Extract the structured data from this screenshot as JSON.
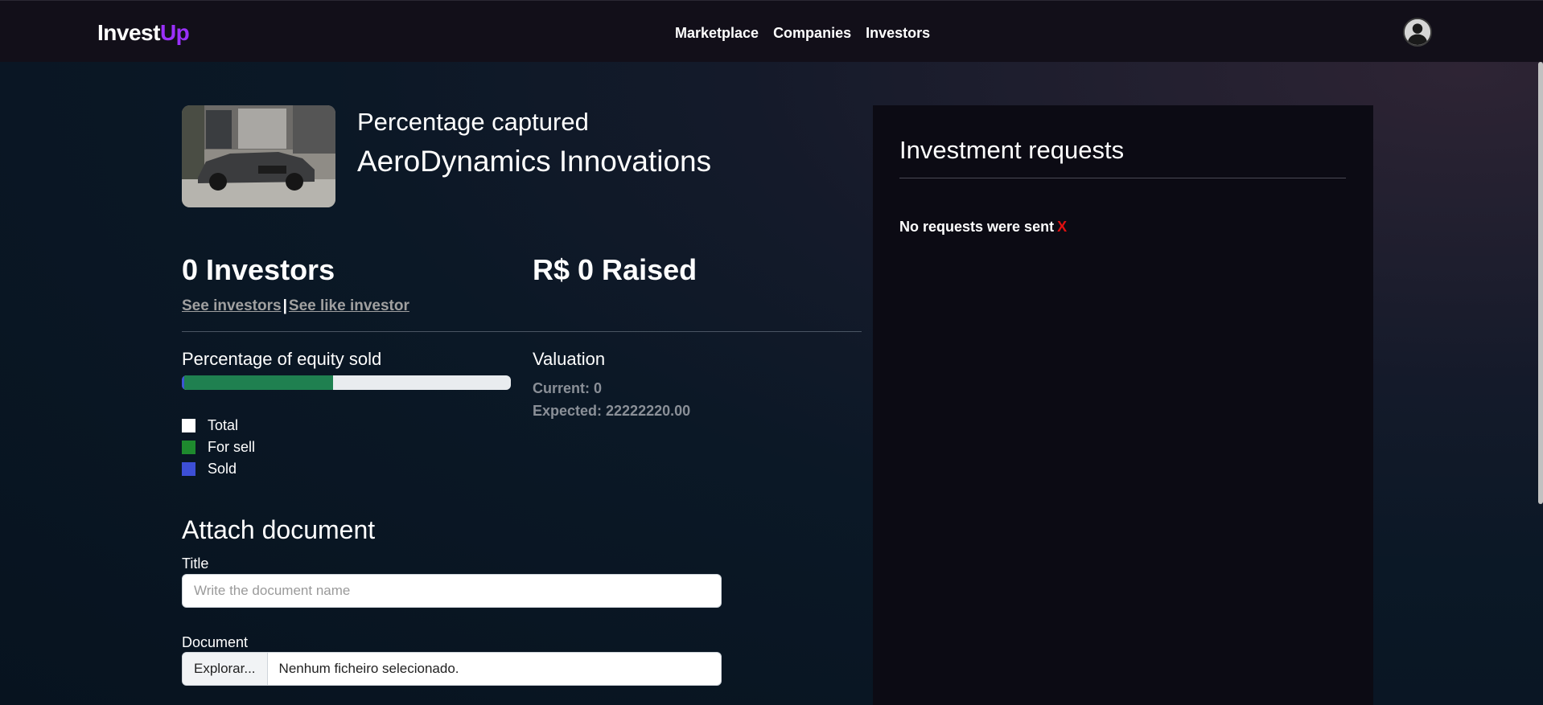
{
  "brand": {
    "part1": "Invest",
    "part2": "Up"
  },
  "nav": {
    "items": [
      "Marketplace",
      "Companies",
      "Investors"
    ]
  },
  "company": {
    "subtitle": "Percentage captured",
    "name": "AeroDynamics Innovations"
  },
  "stats": {
    "investors": "0 Investors",
    "raised": "R$ 0 Raised",
    "see_investors": "See investors",
    "separator": "|",
    "see_like_investor": "See like investor"
  },
  "equity": {
    "label": "Percentage of equity sold",
    "for_sell_fraction": 0.46,
    "sold_fraction": 0.0,
    "legend": [
      {
        "label": "Total",
        "color": "#ffffff"
      },
      {
        "label": "For sell",
        "color": "#1e8a2e"
      },
      {
        "label": "Sold",
        "color": "#3d4fd6"
      }
    ]
  },
  "valuation": {
    "label": "Valuation",
    "current": "Current: 0",
    "expected": "Expected: 22222220.00"
  },
  "attach": {
    "title": "Attach document",
    "title_label": "Title",
    "title_placeholder": "Write the document name",
    "document_label": "Document",
    "browse_label": "Explorar...",
    "file_status": "Nenhum ficheiro selecionado."
  },
  "requests": {
    "title": "Investment requests",
    "empty_text": "No requests were sent",
    "empty_icon": "X"
  },
  "colors": {
    "brand_accent": "#9b30ff",
    "progress_fill": "#1f8050",
    "error": "#e01010"
  }
}
